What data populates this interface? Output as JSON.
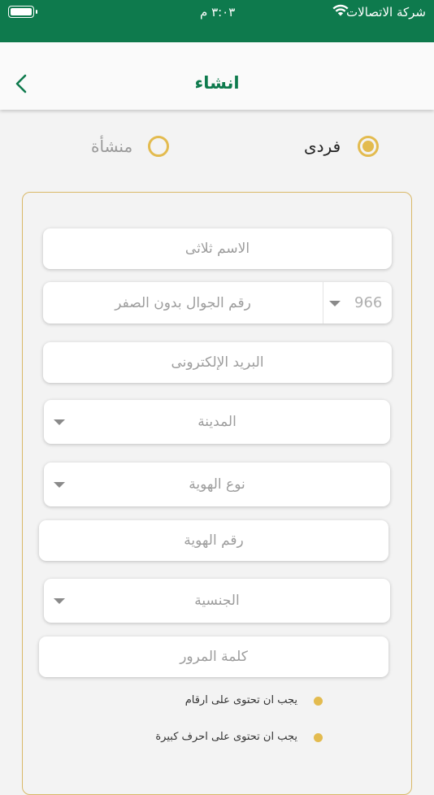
{
  "status_bar": {
    "carrier": "شركة الاتصالات",
    "time": "٣:٠٣ م",
    "icons": [
      "wifi-icon",
      "battery-icon"
    ]
  },
  "nav": {
    "title": "انشاء",
    "back_icon": "chevron-left-icon"
  },
  "account_type": {
    "options": [
      {
        "label": "فردى",
        "selected": true
      },
      {
        "label": "منشأة",
        "selected": false
      }
    ]
  },
  "form": {
    "full_name_placeholder": "الاسم ثلاثى",
    "phone": {
      "country_code": "966",
      "placeholder": "رقم الجوال بدون الصفر"
    },
    "email_placeholder": "البريد الإلكترونى",
    "city_placeholder": "المدينة",
    "id_type_placeholder": "نوع الهوية",
    "id_number_placeholder": "رقم الهوية",
    "nationality_placeholder": "الجنسية",
    "password_placeholder": "كلمة المرور"
  },
  "password_rules": [
    "يجب ان تحتوى على ارقام",
    "يجب ان تحتوى على احرف كبيرة"
  ],
  "colors": {
    "brand_green": "#0e7a4d",
    "accent_gold": "#e3bb4f",
    "background": "#f3f3f3"
  }
}
